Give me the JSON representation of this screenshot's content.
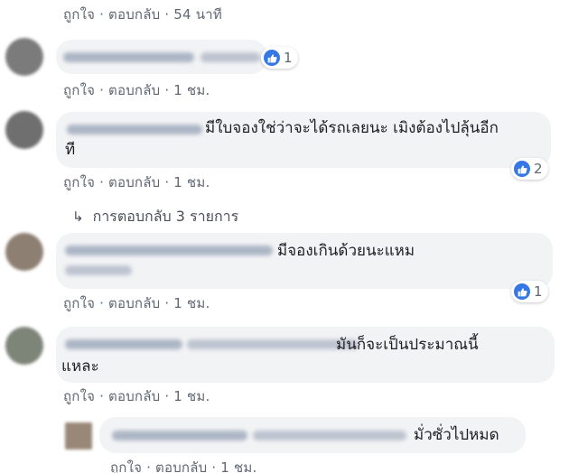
{
  "colors": {
    "like_blue": "#3578e5",
    "bubble": "#f2f3f5",
    "meta_text": "#606770"
  },
  "comments": [
    {
      "like_label": "ถูกใจ",
      "reply_label": "ตอบกลับ",
      "time": "54 นาที"
    },
    {
      "text": "",
      "reactions": {
        "icon": "like-icon",
        "count": "1"
      },
      "like_label": "ถูกใจ",
      "reply_label": "ตอบกลับ",
      "time": "1 ชม."
    },
    {
      "text_line1": "มีใบจองใช่ว่าจะได้รถเลยนะ เมิงต้องไปลุ้นอีก",
      "text_line2": "ที",
      "reactions": {
        "icon": "like-icon",
        "count": "2"
      },
      "like_label": "ถูกใจ",
      "reply_label": "ตอบกลับ",
      "time": "1 ชม."
    },
    {
      "replies_label": "การตอบกลับ 3 รายการ"
    },
    {
      "text": "มีจองเกินด้วยนะแหม",
      "reactions": {
        "icon": "like-icon",
        "count": "1"
      },
      "like_label": "ถูกใจ",
      "reply_label": "ตอบกลับ",
      "time": "1 ชม."
    },
    {
      "text_line1": "มันก็จะเป็นประมาณนี้",
      "text_line2": "แหละ",
      "like_label": "ถูกใจ",
      "reply_label": "ตอบกลับ",
      "time": "1 ชม."
    },
    {
      "text": "มั่วซั่วไปหมด",
      "like_label": "ถูกใจ",
      "reply_label": "ตอบกลับ",
      "time": "1 ชม."
    }
  ],
  "separator": "·"
}
